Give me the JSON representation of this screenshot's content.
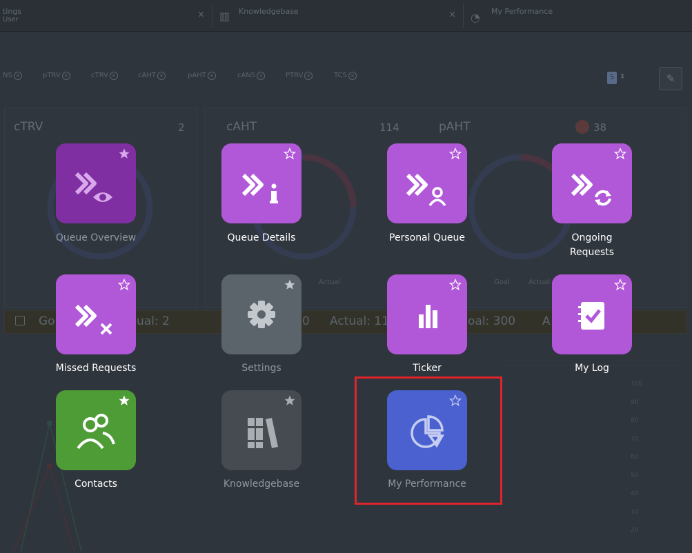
{
  "tabs": [
    {
      "label_line1": "tings",
      "label_line2": "User",
      "close": "×"
    },
    {
      "label": "Knowledgebase",
      "close": "×"
    },
    {
      "label": "My Performance"
    }
  ],
  "filters": [
    "NS",
    "pTRV",
    "cTRV",
    "cAHT",
    "pAHT",
    "cANS",
    "PTRV",
    "TCS"
  ],
  "filter_remove": "⊗",
  "pager": {
    "value": "5",
    "arrows": "⬍"
  },
  "panels": {
    "ctrv": {
      "title": "cTRV",
      "value": "2"
    },
    "caht": {
      "title": "cAHT",
      "value": "114"
    },
    "paht": {
      "title": "pAHT",
      "value": "38"
    },
    "actual_lbl": "Actual",
    "goal_lbl": "Goal",
    "actual_lbl2": "Actual"
  },
  "footer": {
    "f1": "Go",
    "f2": "ual: 2",
    "f3": "0",
    "f4": "Actual: 11",
    "f5": "oal: 300",
    "f6": "A"
  },
  "y_axis_ticks": [
    "100",
    "90",
    "80",
    "70",
    "60",
    "50",
    "40",
    "30",
    "20"
  ],
  "apps": [
    {
      "id": "queue-overview",
      "label": "Queue Overview",
      "color": "#7f2fa2",
      "starred": true,
      "dim": true
    },
    {
      "id": "queue-details",
      "label": "Queue Details",
      "color": "#b158d8",
      "starred": false,
      "dim": false
    },
    {
      "id": "personal-queue",
      "label": "Personal Queue",
      "color": "#b158d8",
      "starred": false,
      "dim": false
    },
    {
      "id": "ongoing-requests",
      "label_line1": "Ongoing",
      "label_line2": "Requests",
      "color": "#b158d8",
      "starred": false,
      "dim": false
    },
    {
      "id": "missed-requests",
      "label": "Missed Requests",
      "color": "#b158d8",
      "starred": false,
      "dim": false
    },
    {
      "id": "settings",
      "label": "Settings",
      "color": "#5b636b",
      "starred": true,
      "dim": true
    },
    {
      "id": "ticker",
      "label": "Ticker",
      "color": "#b158d8",
      "starred": false,
      "dim": false
    },
    {
      "id": "my-log",
      "label": "My Log",
      "color": "#b158d8",
      "starred": false,
      "dim": false
    },
    {
      "id": "contacts",
      "label": "Contacts",
      "color": "#4e9c36",
      "starred": true,
      "dim": false
    },
    {
      "id": "knowledgebase",
      "label": "Knowledgebase",
      "color": "#464b52",
      "starred": true,
      "dim": true
    },
    {
      "id": "my-performance",
      "label": "My Performance",
      "color": "#4a61cf",
      "starred": false,
      "dim": true,
      "highlighted": true,
      "highlight_color": "#e0242b"
    }
  ]
}
